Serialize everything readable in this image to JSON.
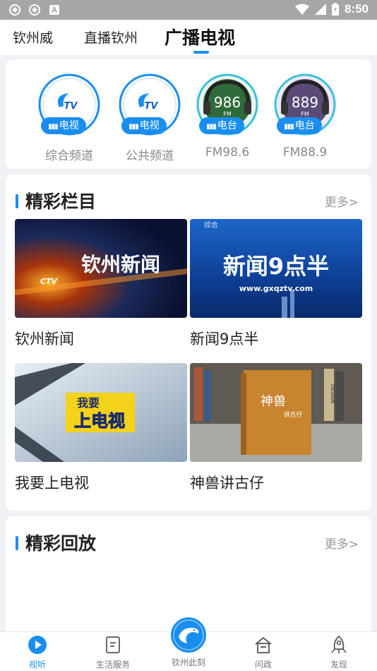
{
  "statusbar": {
    "time": "8:50"
  },
  "top_tabs": [
    {
      "label": "钦州威"
    },
    {
      "label": "直播钦州"
    },
    {
      "label": "广播电视",
      "active": true
    }
  ],
  "channels": [
    {
      "name": "综合频道",
      "badge": "电视",
      "logo_text": "CTV",
      "kind": "tv"
    },
    {
      "name": "公共频道",
      "badge": "电视",
      "logo_text": "CTV",
      "kind": "tv"
    },
    {
      "name": "FM98.6",
      "badge": "电台",
      "logo_text": "986",
      "logo_sub": "FM",
      "kind": "radio"
    },
    {
      "name": "FM88.9",
      "badge": "电台",
      "logo_text": "889",
      "logo_sub": "FM",
      "kind": "radio"
    }
  ],
  "featured": {
    "title": "精彩栏目",
    "more": "更多>",
    "programs": [
      {
        "name": "钦州新闻",
        "thumb_text": "钦州新闻",
        "thumb_sub": "CTV"
      },
      {
        "name": "新闻9点半",
        "thumb_text": "新闻9点半",
        "thumb_sub": "www.gxqztv.com",
        "thumb_top": "综合"
      },
      {
        "name": "我要上电视",
        "thumb_text": "上电视",
        "thumb_top": "我要"
      },
      {
        "name": "神兽讲古仔",
        "thumb_text": "神兽",
        "thumb_sub": "讲古仔",
        "thumb_side": "DESIGN"
      }
    ]
  },
  "replay": {
    "title": "精彩回放",
    "more": "更多>"
  },
  "bottom_nav": [
    {
      "label": "视听",
      "icon": "play-icon",
      "active": true
    },
    {
      "label": "生活服务",
      "icon": "document-icon"
    },
    {
      "label": "钦州此刻",
      "icon": "dolphin-globe-icon"
    },
    {
      "label": "问政",
      "icon": "home-icon"
    },
    {
      "label": "发现",
      "icon": "rocket-icon"
    }
  ],
  "colors": {
    "accent": "#1a8ef0",
    "background": "#eff1f4",
    "statusbar": "#a6a6a6"
  }
}
